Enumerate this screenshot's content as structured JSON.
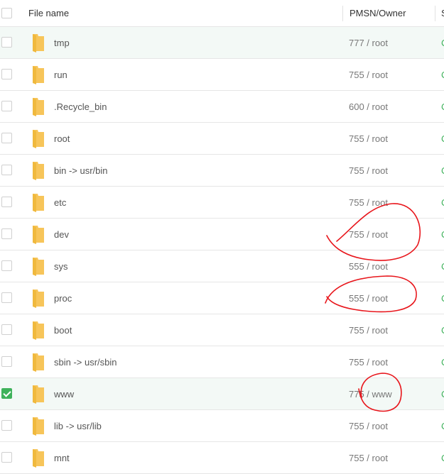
{
  "header": {
    "name_label": "File name",
    "perm_label": "PMSN/Owner",
    "next_label": "S"
  },
  "rows": [
    {
      "name": "tmp",
      "perm": "777 / root",
      "next": "C",
      "checked": false
    },
    {
      "name": "run",
      "perm": "755 / root",
      "next": "C",
      "checked": false
    },
    {
      "name": ".Recycle_bin",
      "perm": "600 / root",
      "next": "C",
      "checked": false
    },
    {
      "name": "root",
      "perm": "755 / root",
      "next": "C",
      "checked": false
    },
    {
      "name": "bin -> usr/bin",
      "perm": "755 / root",
      "next": "C",
      "checked": false
    },
    {
      "name": "etc",
      "perm": "755 / root",
      "next": "C",
      "checked": false
    },
    {
      "name": "dev",
      "perm": "755 / root",
      "next": "C",
      "checked": false
    },
    {
      "name": "sys",
      "perm": "555 / root",
      "next": "C",
      "checked": false
    },
    {
      "name": "proc",
      "perm": "555 / root",
      "next": "C",
      "checked": false
    },
    {
      "name": "boot",
      "perm": "755 / root",
      "next": "C",
      "checked": false
    },
    {
      "name": "sbin -> usr/sbin",
      "perm": "755 / root",
      "next": "C",
      "checked": false
    },
    {
      "name": "www",
      "perm": "775 / www",
      "next": "C",
      "checked": true
    },
    {
      "name": "lib -> usr/lib",
      "perm": "755 / root",
      "next": "C",
      "checked": false
    },
    {
      "name": "mnt",
      "perm": "755 / root",
      "next": "C",
      "checked": false
    }
  ],
  "colors": {
    "accent": "#3fb25b",
    "folder": "#f7c55a",
    "annotation": "#e8151b"
  },
  "icons": {
    "folder": "folder-icon",
    "checkbox": "checkbox-icon"
  }
}
